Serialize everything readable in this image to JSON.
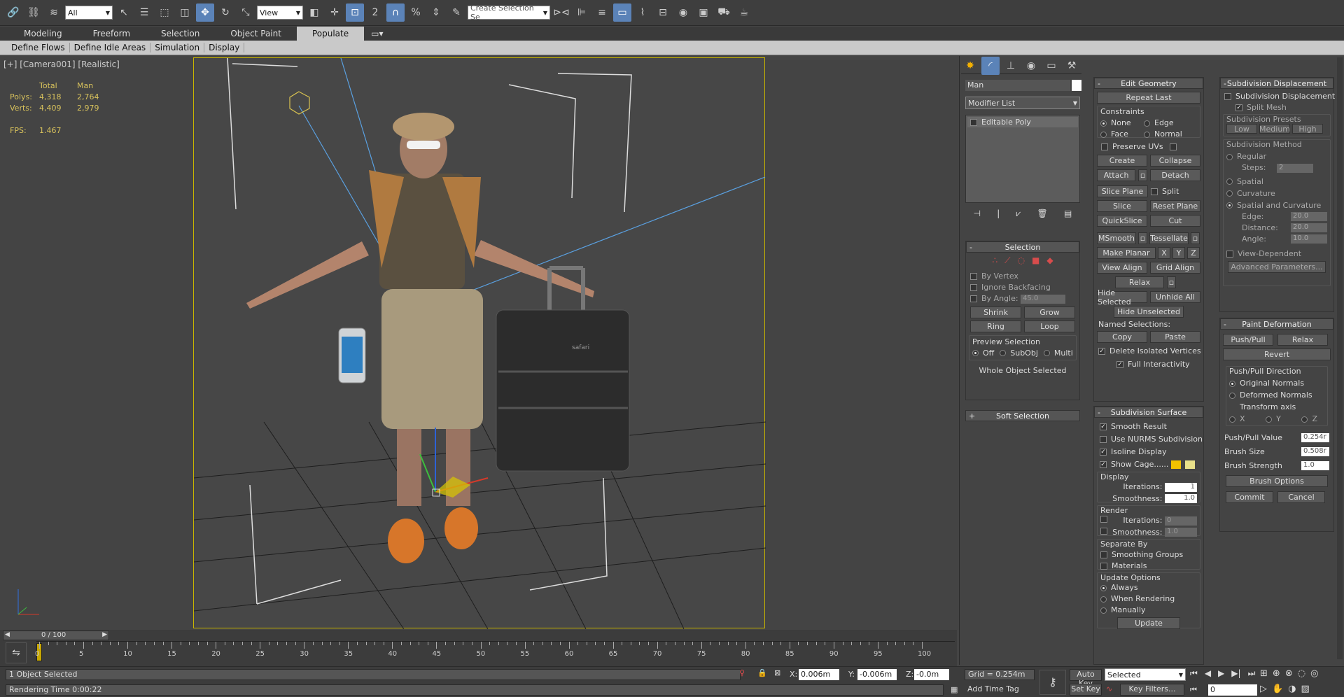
{
  "toolbar": {
    "filter": "All",
    "refcoord": "View",
    "snap2": "2",
    "snap3": "3",
    "angle": "%",
    "selset_placeholder": "Create Selection Se",
    "icons": [
      "link-icon",
      "unlink-icon",
      "bind-spacewarp-icon",
      "select-icon",
      "select-by-name-icon",
      "rect-region-icon",
      "window-crossing-icon",
      "move-icon",
      "rotate-icon",
      "scale-icon",
      "selection-lock-icon",
      "pivot-icon",
      "manipulate-icon",
      "snaps-icon",
      "angle-snap-icon",
      "percent-snap-icon",
      "spinner-snap-icon",
      "edit-named-sel-icon",
      "mirror-icon",
      "align-icon",
      "layer-icon",
      "graphite-icon",
      "curve-editor-icon",
      "schematic-icon",
      "material-editor-icon",
      "render-setup-icon",
      "rendered-frame-icon",
      "render-icon",
      "render-iterative-icon"
    ]
  },
  "ribbon": {
    "tabs": [
      "Modeling",
      "Freeform",
      "Selection",
      "Object Paint",
      "Populate"
    ],
    "active": 4,
    "subtabs": [
      "Define Flows",
      "Define Idle Areas",
      "Simulation",
      "Display"
    ]
  },
  "viewport": {
    "label": "[+] [Camera001] [Realistic]",
    "stats": {
      "h_total": "Total",
      "h_man": "Man",
      "polys_label": "Polys:",
      "polys_total": "4,318",
      "polys_man": "2,764",
      "verts_label": "Verts:",
      "verts_total": "4,409",
      "verts_man": "2,979",
      "fps_label": "FPS:",
      "fps": "1.467"
    },
    "suitcase_brand": "safari"
  },
  "timeline": {
    "frame": "0 / 100",
    "ticks": [
      "0",
      "5",
      "10",
      "15",
      "20",
      "25",
      "30",
      "35",
      "40",
      "45",
      "50",
      "55",
      "60",
      "65",
      "70",
      "75",
      "80",
      "85",
      "90",
      "95",
      "100"
    ]
  },
  "status": {
    "selected": "1 Object Selected",
    "render_time": "Rendering Time  0:00:22",
    "x_label": "X:",
    "x": "0.006m",
    "y_label": "Y:",
    "y": "-0.006m",
    "z_label": "Z:",
    "z": "-0.0m",
    "grid": "Grid = 0.254m",
    "add_time_tag": "Add Time Tag",
    "auto_key": "Auto Key",
    "set_key": "Set Key",
    "key_mode": "Selected",
    "key_filters": "Key Filters...",
    "frame": "0"
  },
  "cmd": {
    "object_name": "Man",
    "modifier_list": "Modifier List",
    "stack_item": "Editable Poly",
    "selection": {
      "title": "Selection",
      "by_vertex": "By Vertex",
      "ignore_backfacing": "Ignore Backfacing",
      "by_angle": "By Angle:",
      "angle": "45.0",
      "shrink": "Shrink",
      "grow": "Grow",
      "ring": "Ring",
      "loop": "Loop",
      "preview": "Preview Selection",
      "off": "Off",
      "subobj": "SubObj",
      "multi": "Multi",
      "status": "Whole Object Selected"
    },
    "soft_selection": "Soft Selection"
  },
  "edit_geometry": {
    "title": "Edit Geometry",
    "repeat_last": "Repeat Last",
    "constraints": "Constraints",
    "none": "None",
    "edge": "Edge",
    "face": "Face",
    "normal": "Normal",
    "preserve_uvs": "Preserve UVs",
    "create": "Create",
    "collapse": "Collapse",
    "attach": "Attach",
    "detach": "Detach",
    "slice_plane": "Slice Plane",
    "split": "Split",
    "slice": "Slice",
    "reset_plane": "Reset Plane",
    "quickslice": "QuickSlice",
    "cut": "Cut",
    "msmooth": "MSmooth",
    "tessellate": "Tessellate",
    "make_planar": "Make Planar",
    "x": "X",
    "y": "Y",
    "z": "Z",
    "view_align": "View Align",
    "grid_align": "Grid Align",
    "relax": "Relax",
    "hide_selected": "Hide Selected",
    "unhide_all": "Unhide All",
    "hide_unselected": "Hide Unselected",
    "named_selections": "Named Selections:",
    "copy": "Copy",
    "paste": "Paste",
    "delete_isolated": "Delete Isolated Vertices",
    "full_interactivity": "Full Interactivity"
  },
  "subdiv_surface": {
    "title": "Subdivision Surface",
    "smooth_result": "Smooth Result",
    "use_nurms": "Use NURMS Subdivision",
    "isoline": "Isoline Display",
    "show_cage": "Show Cage......",
    "display": "Display",
    "iterations": "Iterations:",
    "iter_val": "1",
    "smoothness": "Smoothness:",
    "smooth_val": "1.0",
    "render": "Render",
    "r_iter_val": "0",
    "r_smooth_val": "1.0",
    "separate_by": "Separate By",
    "smoothing_groups": "Smoothing Groups",
    "materials": "Materials",
    "update_options": "Update Options",
    "always": "Always",
    "when_rendering": "When Rendering",
    "manually": "Manually",
    "update": "Update",
    "cage_color1": "#f2c200",
    "cage_color2": "#e8e08a"
  },
  "subdiv_disp": {
    "title": "Subdivision Displacement",
    "sd": "Subdivision Displacement",
    "split_mesh": "Split Mesh",
    "presets": "Subdivision Presets",
    "low": "Low",
    "medium": "Medium",
    "high": "High",
    "method": "Subdivision Method",
    "regular": "Regular",
    "steps": "Steps:",
    "steps_val": "2",
    "spatial": "Spatial",
    "curvature": "Curvature",
    "spatial_curv": "Spatial and Curvature",
    "edge": "Edge:",
    "edge_val": "20.0",
    "distance": "Distance:",
    "distance_val": "20.0",
    "angle": "Angle:",
    "angle_val": "10.0",
    "view_dep": "View-Dependent",
    "advanced": "Advanced Parameters..."
  },
  "paint_deform": {
    "title": "Paint Deformation",
    "push_pull": "Push/Pull",
    "relax": "Relax",
    "revert": "Revert",
    "direction": "Push/Pull Direction",
    "original_normals": "Original Normals",
    "deformed_normals": "Deformed Normals",
    "transform_axis": "Transform axis",
    "x": "X",
    "y": "Y",
    "z": "Z",
    "pp_value": "Push/Pull Value",
    "pp_val": "0.254r",
    "brush_size": "Brush Size",
    "bs_val": "0.508r",
    "brush_strength": "Brush Strength",
    "bst_val": "1.0",
    "brush_options": "Brush Options",
    "commit": "Commit",
    "cancel": "Cancel"
  }
}
